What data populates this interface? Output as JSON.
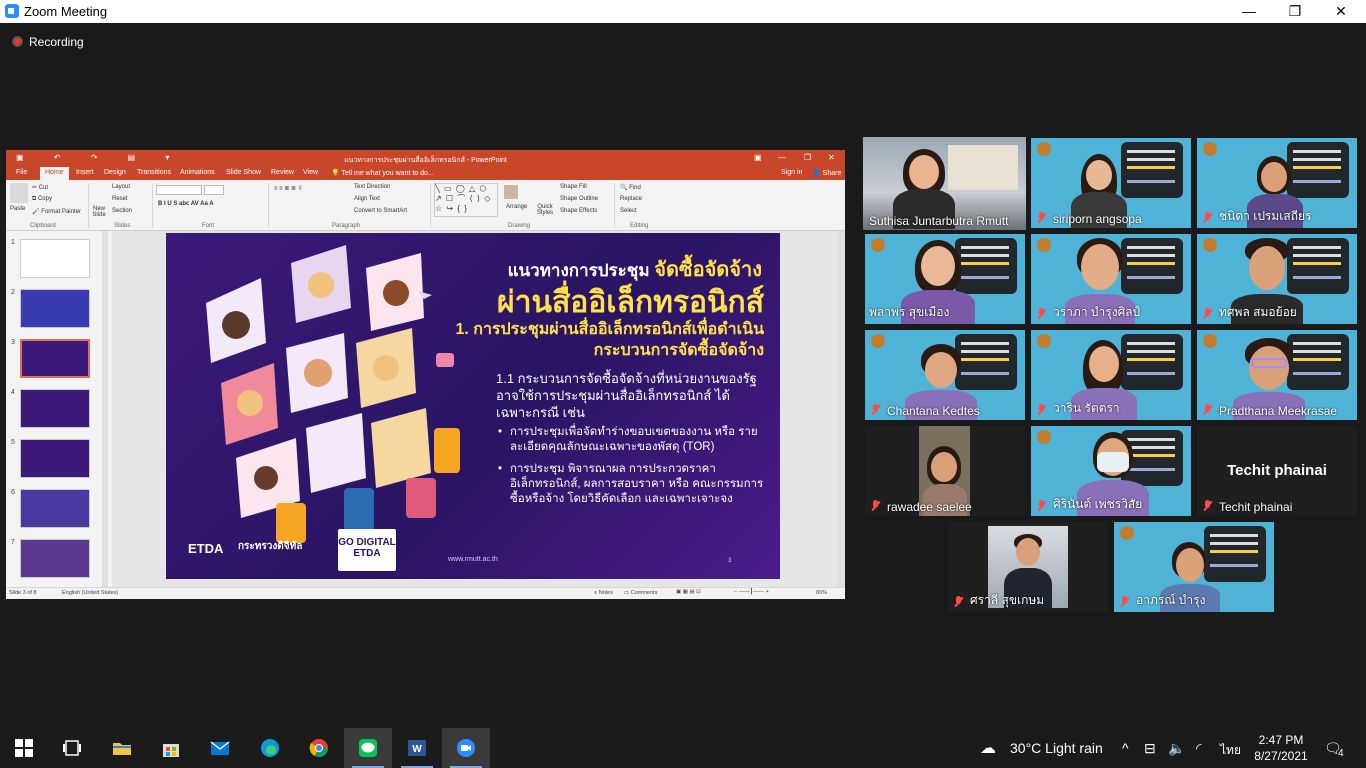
{
  "window": {
    "title": "Zoom Meeting",
    "minimize": "—",
    "maximize": "❐",
    "close": "✕"
  },
  "recording": {
    "label": "Recording"
  },
  "ppt": {
    "doc_title": "แนวทางการประชุมผ่านสื่ออิเล็กทรอนิกส์ - PowerPoint",
    "tabs": [
      "File",
      "Home",
      "Insert",
      "Design",
      "Transitions",
      "Animations",
      "Slide Show",
      "Review",
      "View"
    ],
    "tell_me": "Tell me what you want to do...",
    "sign_in": "Sign in",
    "share": "Share",
    "clipboard": {
      "paste": "Paste",
      "cut": "Cut",
      "copy": "Copy",
      "format_painter": "Format Painter",
      "group": "Clipboard"
    },
    "slides": {
      "new_slide": "New Slide",
      "layout": "Layout",
      "reset": "Reset",
      "section": "Section",
      "group": "Slides"
    },
    "font_group": "Font",
    "paragraph": {
      "text_direction": "Text Direction",
      "align_text": "Align Text",
      "convert": "Convert to SmartArt",
      "group": "Paragraph"
    },
    "drawing": {
      "arrange": "Arrange",
      "quick_styles": "Quick Styles",
      "shape_fill": "Shape Fill",
      "shape_outline": "Shape Outline",
      "shape_effects": "Shape Effects",
      "group": "Drawing"
    },
    "editing": {
      "find": "Find",
      "replace": "Replace",
      "select": "Select",
      "group": "Editing"
    },
    "thumb_numbers": [
      "1",
      "2",
      "3",
      "4",
      "5",
      "6",
      "7"
    ],
    "status": {
      "slide_of": "Slide 3 of 8",
      "language": "English (United States)",
      "notes": "Notes",
      "comments": "Comments",
      "zoom": "80%"
    }
  },
  "slide": {
    "subtitle": "แนวทางการประชุม",
    "subtitle_highlight": "จัดซื้อจัดจ้าง",
    "main_title": "ผ่านสื่ออิเล็กทรอนิกส์",
    "heading1": "1. การประชุมผ่านสื่ออิเล็กทรอนิกส์เพื่อดำเนิน กระบวนการจัดซื้อจัดจ้าง",
    "heading2": "1.1 กระบวนการจัดซื้อจัดจ้างที่หน่วยงานของรัฐ อาจใช้การประชุมผ่านสื่ออิเล็กทรอนิกส์ ได้เฉพาะกรณี เช่น",
    "bullets": [
      "การประชุมเพื่อจัดทำร่างขอบเขตของงาน หรือ รายละเอียดคุณลักษณะเฉพาะของพัสดุ (TOR)",
      "การประชุม พิจารณาผล การประกวดราคา อิเล็กทรอนิกส์, ผลการสอบราคา หรือ คณะกรรมการซื้อหรือจ้าง โดยวิธีคัดเลือก และเฉพาะเจาะจง"
    ],
    "etda": "ETDA",
    "ministry": "กระทรวงดิจิทัล",
    "go_digital": "GO DIGITAL ETDA",
    "url": "www.rmutt.ac.th",
    "page": "3"
  },
  "participants": [
    {
      "name": "Suthisa  Juntarbutra Rmutt",
      "muted": false,
      "speaking": true,
      "video": true,
      "vbg": false
    },
    {
      "name": "siriporn angsopa",
      "muted": true,
      "video": true,
      "vbg": true
    },
    {
      "name": "ชนิดา เปรมเสถียร",
      "muted": true,
      "video": true,
      "vbg": true
    },
    {
      "name": "พลาพร สุขเมือง",
      "muted": false,
      "video": true,
      "vbg": true
    },
    {
      "name": "วราภา บำรุงศิลป์",
      "muted": true,
      "video": true,
      "vbg": true
    },
    {
      "name": "ทศพล สมอย้อย",
      "muted": true,
      "video": true,
      "vbg": true
    },
    {
      "name": "Chantana Kedtes",
      "muted": true,
      "video": true,
      "vbg": true
    },
    {
      "name": "วาริน รัตตรา",
      "muted": true,
      "video": true,
      "vbg": true
    },
    {
      "name": "Pradthana Meekrasae",
      "muted": true,
      "video": true,
      "vbg": true
    },
    {
      "name": "rawadee saelee",
      "muted": true,
      "video": true,
      "vbg": false
    },
    {
      "name": "ศิรินันต์ เพชรวิสัย",
      "muted": true,
      "video": true,
      "vbg": true
    },
    {
      "name": "Techit phainai",
      "muted": true,
      "video": false,
      "vbg": false
    },
    {
      "name": "ศราลี สุขเกษม",
      "muted": true,
      "video": true,
      "vbg": false
    },
    {
      "name": "อาภรณ์ บำรุง",
      "muted": true,
      "video": true,
      "vbg": true
    }
  ],
  "taskbar": {
    "apps": [
      "start-icon",
      "task-view-icon",
      "file-explorer-icon",
      "store-icon",
      "mail-icon",
      "edge-icon",
      "chrome-icon",
      "line-icon",
      "word-icon",
      "zoom-icon"
    ],
    "weather": "30°C  Light rain",
    "language": "ไทย",
    "time": "2:47 PM",
    "date": "8/27/2021",
    "notifications": "4"
  },
  "colors": {
    "ppt_accent": "#c8472b",
    "speaking_border": "#c6e55a",
    "muted_red": "#ff4b4b",
    "slide_yellow": "#ffe14a"
  }
}
